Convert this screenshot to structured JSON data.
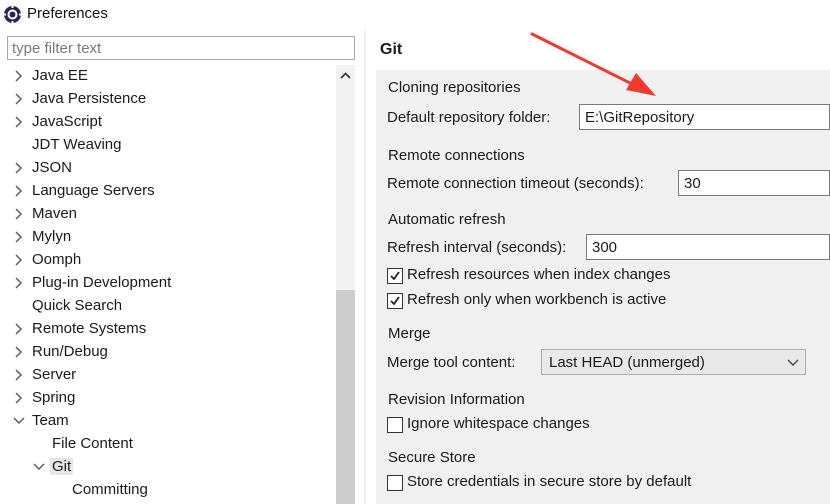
{
  "window": {
    "title": "Preferences",
    "icon": "eclipse-preferences-icon"
  },
  "filter": {
    "placeholder": "type filter text",
    "value": ""
  },
  "tree": {
    "items": [
      {
        "label": "Java EE",
        "expandable": true,
        "expanded": false,
        "depth": 0
      },
      {
        "label": "Java Persistence",
        "expandable": true,
        "expanded": false,
        "depth": 0
      },
      {
        "label": "JavaScript",
        "expandable": true,
        "expanded": false,
        "depth": 0
      },
      {
        "label": "JDT Weaving",
        "expandable": false,
        "expanded": false,
        "depth": 0
      },
      {
        "label": "JSON",
        "expandable": true,
        "expanded": false,
        "depth": 0
      },
      {
        "label": "Language Servers",
        "expandable": true,
        "expanded": false,
        "depth": 0
      },
      {
        "label": "Maven",
        "expandable": true,
        "expanded": false,
        "depth": 0
      },
      {
        "label": "Mylyn",
        "expandable": true,
        "expanded": false,
        "depth": 0
      },
      {
        "label": "Oomph",
        "expandable": true,
        "expanded": false,
        "depth": 0
      },
      {
        "label": "Plug-in Development",
        "expandable": true,
        "expanded": false,
        "depth": 0
      },
      {
        "label": "Quick Search",
        "expandable": false,
        "expanded": false,
        "depth": 0
      },
      {
        "label": "Remote Systems",
        "expandable": true,
        "expanded": false,
        "depth": 0
      },
      {
        "label": "Run/Debug",
        "expandable": true,
        "expanded": false,
        "depth": 0
      },
      {
        "label": "Server",
        "expandable": true,
        "expanded": false,
        "depth": 0
      },
      {
        "label": "Spring",
        "expandable": true,
        "expanded": false,
        "depth": 0
      },
      {
        "label": "Team",
        "expandable": true,
        "expanded": true,
        "depth": 0
      },
      {
        "label": "File Content",
        "expandable": false,
        "expanded": false,
        "depth": 1
      },
      {
        "label": "Git",
        "expandable": true,
        "expanded": true,
        "depth": 1,
        "selected": true
      },
      {
        "label": "Committing",
        "expandable": false,
        "expanded": false,
        "depth": 2
      }
    ]
  },
  "page": {
    "title": "Git",
    "cloning": {
      "group_title": "Cloning repositories",
      "default_folder_label": "Default repository folder:",
      "default_folder_value": "E:\\GitRepository"
    },
    "remote": {
      "group_title": "Remote connections",
      "timeout_label": "Remote connection timeout (seconds):",
      "timeout_value": "30"
    },
    "refresh": {
      "group_title": "Automatic refresh",
      "interval_label": "Refresh interval (seconds):",
      "interval_value": "300",
      "on_index_change_label": "Refresh resources when index changes",
      "on_index_change_checked": true,
      "only_when_active_label": "Refresh only when workbench is active",
      "only_when_active_checked": true
    },
    "merge": {
      "group_title": "Merge",
      "tool_content_label": "Merge tool content:",
      "tool_content_value": "Last HEAD (unmerged)"
    },
    "revision": {
      "group_title": "Revision Information",
      "ignore_whitespace_label": "Ignore whitespace changes",
      "ignore_whitespace_checked": false
    },
    "secure_store": {
      "group_title": "Secure Store",
      "store_credentials_label": "Store credentials in secure store by default",
      "store_credentials_checked": false
    }
  },
  "colors": {
    "annotation_arrow": "#f03a2e",
    "page_background": "#f0f0f0",
    "selected_row": "#e6e6e6"
  }
}
